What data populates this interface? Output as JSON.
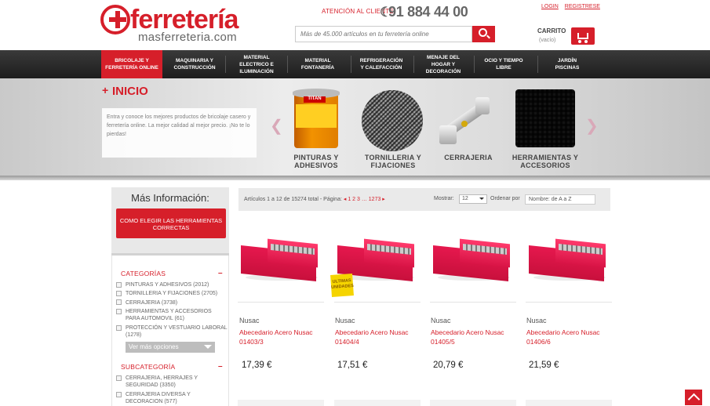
{
  "header": {
    "logo_word": "ferretería",
    "logo_domain": "masferreteria.com",
    "contact_label": "ATENCIÓN AL CLIENTE",
    "phone": "91 884 44 00",
    "search_placeholder": "Más de 45.000 artículos en tu ferretería online",
    "login": "LOGIN",
    "register": "REGISTRESE",
    "cart_label": "CARRITO",
    "cart_status": "(vacío)"
  },
  "nav": [
    {
      "label": "BRICOLAJE Y FERRETERÍA ONLINE",
      "active": true
    },
    {
      "label": "MAQUINARIA Y CONSTRUCCIÓN"
    },
    {
      "label": "MATERIAL ELECTRICO E ILUMINACIÓN"
    },
    {
      "label": "MATERIAL FONTANERÍA"
    },
    {
      "label": "REFRIGERACIÓN Y CALEFACCIÓN"
    },
    {
      "label": "MENAJE DEL HOGAR Y DECORACIÓN"
    },
    {
      "label": "OCIO Y TIEMPO LIBRE"
    },
    {
      "label": "JARDÍN PISCINAS"
    }
  ],
  "banner": {
    "heading": "INICIO",
    "intro": "Entra y conoce los mejores productos de bricolaje casero y ferretería online. La mejor calidad al mejor precio. ¡No te lo pierdas!",
    "categories": [
      {
        "label": "PINTURAS Y ADHESIVOS",
        "brand_text": "TITAN"
      },
      {
        "label": "TORNILLERIA Y FIJACIONES"
      },
      {
        "label": "CERRAJERIA"
      },
      {
        "label": "HERRAMIENTAS Y ACCESORIOS"
      }
    ]
  },
  "sidebar": {
    "title": "Más Información:",
    "cta": "COMO ELEGIR LAS HERRAMIENTAS CORRECTAS",
    "categories_title": "CATEGORÍAS",
    "categories": [
      "PINTURAS Y ADHESIVOS (2012)",
      "TORNILLERIA Y FIJACIONES (2705)",
      "CERRAJERIA (3738)",
      "HERRAMIENTAS Y ACCESORIOS PARA AUTOMOVIL (61)",
      "PROTECCIÓN Y VESTUARIO LABORAL (1278)"
    ],
    "more": "Ver más opciones",
    "subcategories_title": "SUBCATEGORÍA",
    "subcategories": [
      "CERRAJERIA, HERRAJES Y SEGURIDAD (3350)",
      "CERRAJERIA DIVERSA Y DECORACION (577)"
    ]
  },
  "toolbar": {
    "summary": "Artículos 1 a 12 de 15274 total - Página:",
    "pages": "◂ 1 2 3 … 1273 ▸",
    "show_label": "Mostrar:",
    "show_value": "12",
    "order_label": "Ordenar por",
    "order_value": "Nombre: de A a Z"
  },
  "products": [
    {
      "brand": "Nusac",
      "name": "Abecedario Acero Nusac 01403/3",
      "price": "17,39 €"
    },
    {
      "brand": "Nusac",
      "name": "Abecedario Acero Nusac 01404/4",
      "price": "17,51 €",
      "tag": "ULTIMAS UNIDADES"
    },
    {
      "brand": "Nusac",
      "name": "Abecedario Acero Nusac 01405/5",
      "price": "20,79 €"
    },
    {
      "brand": "Nusac",
      "name": "Abecedario Acero Nusac 01406/6",
      "price": "21,59 €"
    }
  ],
  "colors": {
    "accent": "#d61f2a",
    "nav_bg": "#2a2a2a"
  }
}
